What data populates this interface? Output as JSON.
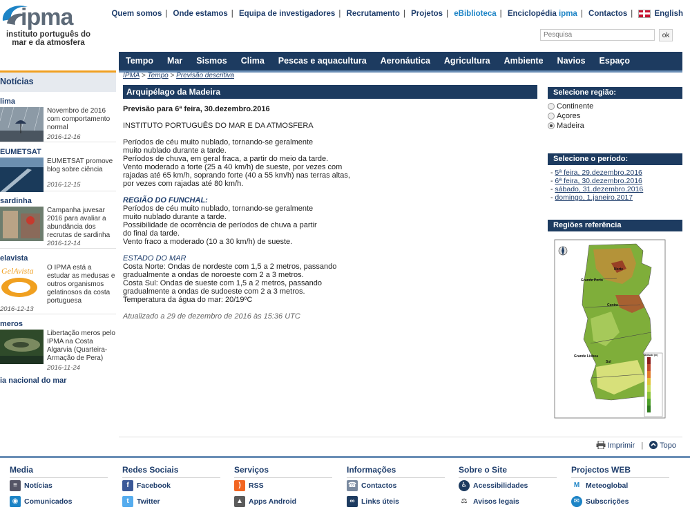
{
  "header": {
    "logo_word": "ipma",
    "logo_sub_line1": "instituto português do",
    "logo_sub_line2": "mar e da atmosfera",
    "top_links": [
      "Quem somos",
      "Onde estamos",
      "Equipa de investigadores",
      "Recrutamento",
      "Projetos",
      "eBiblioteca",
      "Enciclopédia",
      "Contactos"
    ],
    "encyclopedia_suffix": "ipma",
    "language": "English",
    "search_placeholder": "Pesquisa",
    "search_button": "ok"
  },
  "main_nav": [
    "Tempo",
    "Mar",
    "Sismos",
    "Clima",
    "Pescas e aquacultura",
    "Aeronáutica",
    "Agricultura",
    "Ambiente",
    "Navios",
    "Espaço"
  ],
  "news": {
    "title": "Notícias",
    "items": [
      {
        "category": "lima",
        "text": "Novembro de 2016 com comportamento normal",
        "date": "2016-12-16"
      },
      {
        "category": "EUMETSAT",
        "text": "EUMETSAT promove blog sobre ciência",
        "date": "2016-12-15"
      },
      {
        "category": "sardinha",
        "text": "Campanha juvesar 2016 para avaliar a abundância dos recrutas de sardinha",
        "date": "2016-12-14"
      },
      {
        "category": "elavista",
        "text": "O IPMA está a estudar as medusas e outros organismos gelatinosos da costa portuguesa",
        "date": "2016-12-13"
      },
      {
        "category": "meros",
        "text": "Libertação meros pelo IPMA na Costa Algarvia (Quarteira-Armação de Pera)",
        "date": "2016-11-24"
      }
    ],
    "footer": "ia nacional do mar",
    "gelavista_logo": "GelAvista"
  },
  "breadcrumb": {
    "home": "IPMA",
    "section": "Tempo",
    "page": "Previsão descritiva"
  },
  "region_title": "Arquipélago da Madeira",
  "forecast": {
    "heading": "Previsão para 6ª feira, 30.dezembro.2016",
    "institute": "INSTITUTO PORTUGUÊS DO MAR E DA ATMOSFERA",
    "general": [
      "Períodos de céu muito nublado, tornando-se geralmente",
      "muito nublado durante a tarde.",
      "Períodos de chuva, em geral fraca, a partir do meio da tarde.",
      "Vento moderado a forte (25 a 40 km/h) de sueste, por vezes com",
      "rajadas até 65 km/h, soprando forte (40 a 55 km/h) nas terras altas,",
      "por vezes com rajadas até 80 km/h."
    ],
    "funchal_title": "REGIÃO DO FUNCHAL:",
    "funchal": [
      "Períodos de céu muito nublado, tornando-se geralmente",
      "muito nublado durante a tarde.",
      "Possibilidade de ocorrência de períodos de chuva a partir",
      "do final da tarde.",
      "Vento fraco a moderado (10 a 30 km/h) de sueste."
    ],
    "sea_title": "ESTADO DO MAR",
    "sea": [
      "Costa Norte: Ondas de nordeste com 1,5 a 2 metros, passando",
      "gradualmente a ondas de noroeste com 2 a 3 metros.",
      "Costa Sul: Ondas de sueste com 1,5 a 2 metros, passando",
      "gradualmente a ondas de sudoeste com 2 a 3 metros.",
      "Temperatura da água do mar: 20/19ºC"
    ],
    "updated": "Atualizado a 29 de dezembro de 2016 às 15:36 UTC"
  },
  "right": {
    "region_head": "Selecione região:",
    "regions": [
      {
        "label": "Continente",
        "checked": false
      },
      {
        "label": "Açores",
        "checked": false
      },
      {
        "label": "Madeira",
        "checked": true
      }
    ],
    "period_head": "Selecione o período:",
    "periods": [
      "5ª feira, 29.dezembro.2016",
      "6ª feira, 30.dezembro.2016",
      "sábado, 31.dezembro.2016",
      "domingo, 1.janeiro.2017"
    ],
    "map_head": "Regiões referência",
    "map_labels": {
      "north": "Norte",
      "porto": "Grande Porto",
      "centro": "Centro",
      "lisboa": "Grande Lisboa",
      "sul": "Sul",
      "legend_title": "Altitude (m)"
    }
  },
  "tools": {
    "print": "Imprimir",
    "top": "Topo"
  },
  "footer": {
    "columns": [
      {
        "title": "Media",
        "items": [
          {
            "label": "Notícias",
            "icon": "newspaper-icon"
          },
          {
            "label": "Comunicados",
            "icon": "broadcast-icon"
          }
        ]
      },
      {
        "title": "Redes Sociais",
        "items": [
          {
            "label": "Facebook",
            "icon": "facebook-icon"
          },
          {
            "label": "Twitter",
            "icon": "twitter-icon"
          }
        ]
      },
      {
        "title": "Serviços",
        "items": [
          {
            "label": "RSS",
            "icon": "rss-icon"
          },
          {
            "label": "Apps Android",
            "icon": "android-icon"
          }
        ]
      },
      {
        "title": "Informações",
        "items": [
          {
            "label": "Contactos",
            "icon": "contacts-icon"
          },
          {
            "label": "Links úteis",
            "icon": "link-icon"
          }
        ]
      },
      {
        "title": "Sobre o Site",
        "items": [
          {
            "label": "Acessibilidades",
            "icon": "accessibility-icon"
          },
          {
            "label": "Avisos legais",
            "icon": "legal-icon"
          }
        ]
      },
      {
        "title": "Projectos WEB",
        "items": [
          {
            "label": "Meteoglobal",
            "icon": "meteoglobal-icon"
          },
          {
            "label": "Subscrições",
            "icon": "subscriptions-icon"
          }
        ]
      }
    ]
  },
  "colors": {
    "navy": "#1d3b60",
    "accent": "#1d84c6",
    "link": "#1e3d6b",
    "orange": "#f0a020"
  }
}
